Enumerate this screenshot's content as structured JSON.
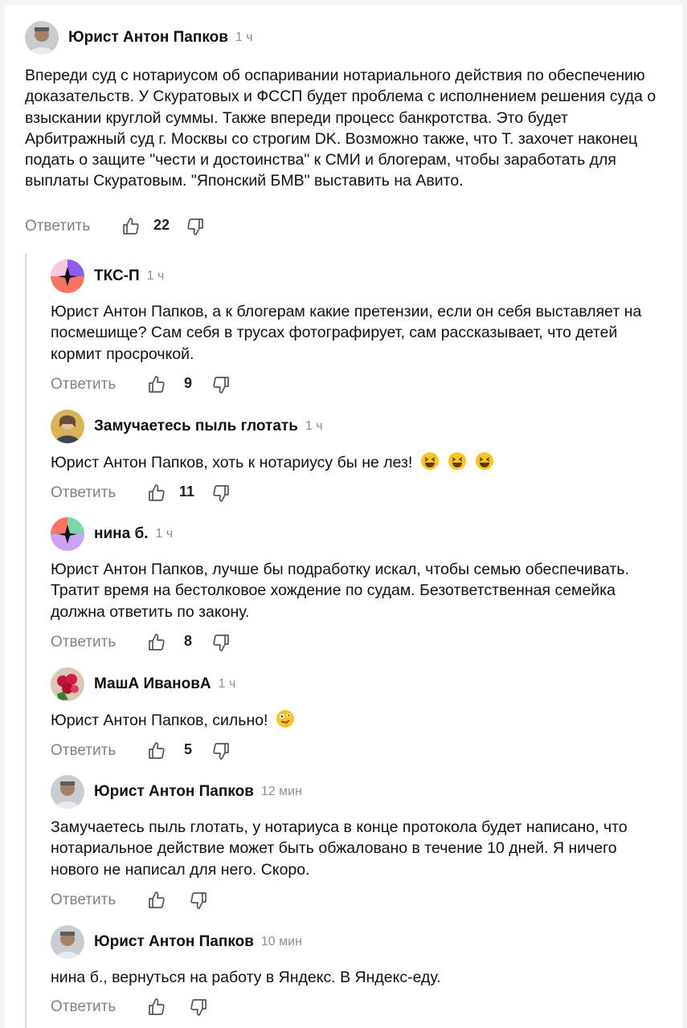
{
  "comments": [
    {
      "author": "Юрист Антон Папков",
      "time": "1 ч",
      "avatar": "person-photo",
      "text": "Впереди суд с нотариусом об оспаривании нотариального действия по обеспечению доказательств. У Скуратовых и ФССП будет проблема с исполнением решения суда о взыскании круглой суммы. Также впереди процесс банкротства. Это будет Арбитражный суд г. Москвы со строгим DK. Возможно также, что Т. захочет наконец подать о защите \"чести и достоинства\" к СМИ и блогерам, чтобы заработать для выплаты Скуратовым. \"Японский БМВ\" выставить на Авито.",
      "reply_label": "Ответить",
      "likes": "22"
    },
    {
      "author": "ТКС-П",
      "time": "1 ч",
      "avatar": "default-avatar-pink",
      "text": "Юрист Антон Папков, а к блогерам какие претензии, если он себя выставляет на посмешище? Сам себя в трусах фотографирует, сам рассказывает, что детей кормит просрочкой.",
      "reply_label": "Ответить",
      "likes": "9"
    },
    {
      "author": "Замучаетесь пыль глотать",
      "time": "1 ч",
      "avatar": "person-photo",
      "text": "Юрист Антон Папков, хоть к нотариусу бы не лез!",
      "emojis": [
        "laughing-face",
        "laughing-face",
        "laughing-face"
      ],
      "reply_label": "Ответить",
      "likes": "11"
    },
    {
      "author": "нина б.",
      "time": "1 ч",
      "avatar": "default-avatar-green",
      "text": "Юрист Антон Папков, лучше бы подработку искал, чтобы семью обеспечивать. Тратит время на бестолковое хождение по судам. Безответственная семейка должна ответить по закону.",
      "reply_label": "Ответить",
      "likes": "8"
    },
    {
      "author": "МашА ИвановА",
      "time": "1 ч",
      "avatar": "flowers-photo",
      "text": "Юрист Антон Папков, сильно!",
      "emojis": [
        "zany-face"
      ],
      "reply_label": "Ответить",
      "likes": "5"
    },
    {
      "author": "Юрист Антон Папков",
      "time": "12 мин",
      "avatar": "person-photo",
      "text": "Замучаетесь пыль глотать, у нотариуса в конце протокола будет написано, что нотариальное действие может быть обжаловано в течение 10 дней. Я ничего нового не написал для него. Скоро.",
      "reply_label": "Ответить",
      "likes": ""
    },
    {
      "author": "Юрист Антон Папков",
      "time": "10 мин",
      "avatar": "person-photo",
      "text": "нина б., вернуться на работу в Яндекс. В Яндекс-еду.",
      "reply_label": "Ответить",
      "likes": ""
    }
  ]
}
